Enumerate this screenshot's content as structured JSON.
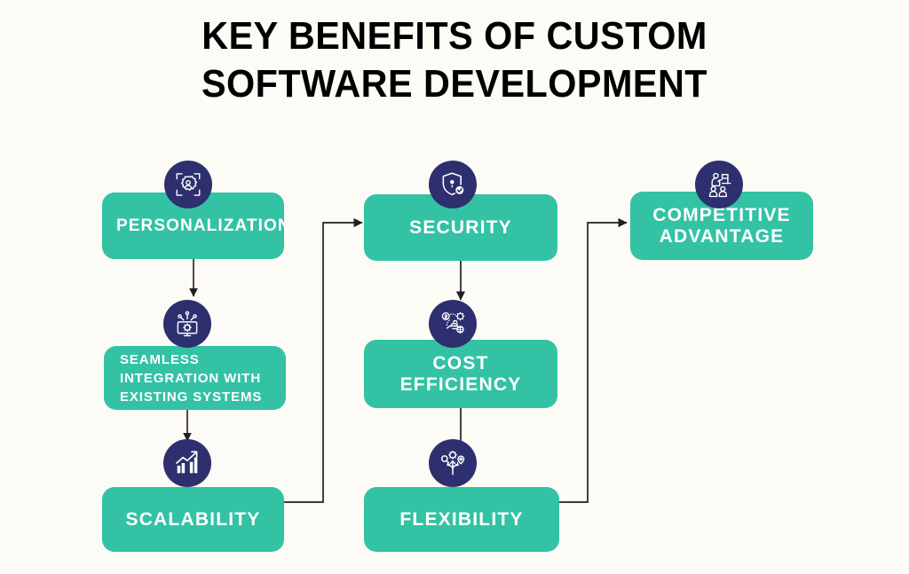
{
  "page": {
    "background_color": "#FDFBF5",
    "accent_teal": "#33C2A4",
    "accent_navy": "#2E2F6E",
    "line_color": "#231F20",
    "text_on_card": "#FFFFFF",
    "title_color": "#000000"
  },
  "title": {
    "line1": "KEY BENEFITS OF CUSTOM",
    "line2": "SOFTWARE DEVELOPMENT"
  },
  "nodes": [
    {
      "id": "personalization",
      "label": "PERSONALIZATION",
      "icon": "gear-person-scan-icon",
      "column": "left",
      "align": "center"
    },
    {
      "id": "seamless_integration",
      "label": "SEAMLESS INTEGRATION WITH EXISTING SYSTEMS",
      "label_line1": "SEAMLESS",
      "label_line2": "INTEGRATION WITH",
      "label_line3": "EXISTING SYSTEMS",
      "icon": "monitor-gear-network-icon",
      "column": "left",
      "align": "left"
    },
    {
      "id": "scalability",
      "label": "SCALABILITY",
      "icon": "growth-chart-icon",
      "column": "left",
      "align": "center"
    },
    {
      "id": "security",
      "label": "SECURITY",
      "icon": "shield-lock-check-icon",
      "column": "middle",
      "align": "center"
    },
    {
      "id": "cost_efficiency",
      "label": "COST EFFICIENCY",
      "label_line1": "COST",
      "label_line2": "EFFICIENCY",
      "icon": "money-hand-gear-icon",
      "column": "middle",
      "align": "center"
    },
    {
      "id": "flexibility",
      "label": "FLEXIBILITY",
      "icon": "branching-path-icon",
      "column": "middle",
      "align": "center"
    },
    {
      "id": "competitive_advantage",
      "label": "COMPETITIVE ADVANTAGE",
      "label_line1": "COMPETITIVE",
      "label_line2": "ADVANTAGE",
      "icon": "team-flag-leader-icon",
      "column": "right",
      "align": "center"
    }
  ],
  "connectors": [
    {
      "id": "personalization-to-integration",
      "from": "personalization",
      "to": "seamless_integration",
      "style": "arrow-down"
    },
    {
      "id": "integration-to-scalability",
      "from": "seamless_integration",
      "to": "scalability",
      "style": "arrow-down"
    },
    {
      "id": "scalability-to-security",
      "from": "scalability",
      "to": "security",
      "style": "elbow-arrow-right"
    },
    {
      "id": "security-to-cost",
      "from": "security",
      "to": "cost_efficiency",
      "style": "arrow-down"
    },
    {
      "id": "cost-to-flexibility",
      "from": "cost_efficiency",
      "to": "flexibility",
      "style": "line-down"
    },
    {
      "id": "flexibility-to-competitive",
      "from": "flexibility",
      "to": "competitive_advantage",
      "style": "elbow-arrow-right"
    }
  ]
}
